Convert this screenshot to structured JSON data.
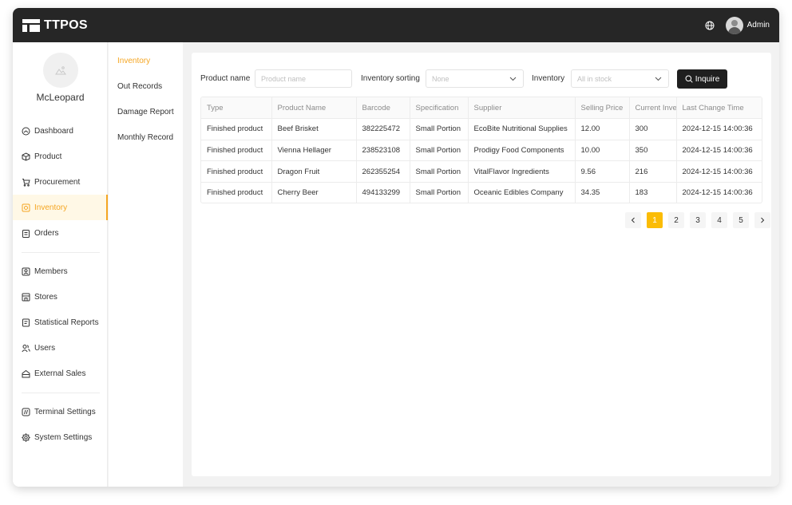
{
  "app": {
    "logo_text": "TTPOS",
    "user_name": "Admin"
  },
  "sidebar": {
    "store_name": "McLeopard",
    "items": [
      {
        "label": "Dashboard",
        "icon": "dashboard-icon"
      },
      {
        "label": "Product",
        "icon": "box-icon"
      },
      {
        "label": "Procurement",
        "icon": "cart-icon"
      },
      {
        "label": "Inventory",
        "icon": "inventory-icon",
        "active": true
      },
      {
        "label": "Orders",
        "icon": "clipboard-icon"
      },
      {
        "label": "Members",
        "icon": "member-icon"
      },
      {
        "label": "Stores",
        "icon": "store-icon"
      },
      {
        "label": "Statistical Reports",
        "icon": "report-icon"
      },
      {
        "label": "Users",
        "icon": "users-icon"
      },
      {
        "label": "External Sales",
        "icon": "external-sales-icon"
      },
      {
        "label": "Terminal Settings",
        "icon": "terminal-icon"
      },
      {
        "label": "System Settings",
        "icon": "gear-icon"
      }
    ]
  },
  "subnav": {
    "items": [
      {
        "label": "Inventory",
        "active": true
      },
      {
        "label": "Out Records"
      },
      {
        "label": "Damage Report"
      },
      {
        "label": "Monthly Record"
      }
    ]
  },
  "filters": {
    "product_name_label": "Product name",
    "product_name_placeholder": "Product name",
    "sorting_label": "Inventory sorting",
    "sorting_value": "None",
    "inventory_label": "Inventory",
    "inventory_value": "All in stock",
    "inquire_label": "Inquire"
  },
  "table": {
    "columns": [
      "Type",
      "Product Name",
      "Barcode",
      "Specification",
      "Supplier",
      "Selling Price",
      "Current Inve",
      "Last Change Time"
    ],
    "rows": [
      [
        "Finished product",
        "Beef Brisket",
        "382225472",
        "Small Portion",
        "EcoBite Nutritional Supplies",
        "12.00",
        "300",
        "2024-12-15 14:00:36"
      ],
      [
        "Finished product",
        "Vienna Hellager",
        "238523108",
        "Small Portion",
        "Prodigy Food Components",
        "10.00",
        "350",
        "2024-12-15 14:00:36"
      ],
      [
        "Finished product",
        "Dragon Fruit",
        "262355254",
        "Small Portion",
        "VitalFlavor Ingredients",
        "9.56",
        "216",
        "2024-12-15 14:00:36"
      ],
      [
        "Finished product",
        "Cherry Beer",
        "494133299",
        "Small Portion",
        "Oceanic Edibles Company",
        "34.35",
        "183",
        "2024-12-15 14:00:36"
      ]
    ]
  },
  "pagination": {
    "pages": [
      "1",
      "2",
      "3",
      "4",
      "5"
    ],
    "current": "1"
  },
  "colors": {
    "accent": "#f5a623",
    "topbar": "#262626",
    "active_page": "#fbbc05"
  }
}
